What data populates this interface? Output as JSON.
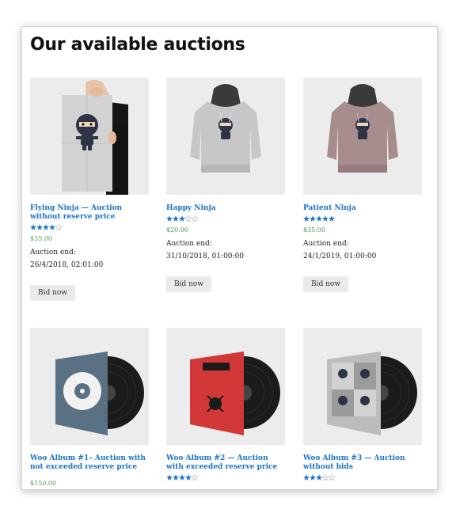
{
  "page": {
    "title": "Our available auctions"
  },
  "colors": {
    "link": "#1a73c9",
    "price": "#4f9a57",
    "star": "#1a73c9",
    "thumb_bg": "#ececec",
    "button_bg": "#ebe9eb"
  },
  "products": [
    {
      "title": "Flying Ninja — Auction without reserve price",
      "rating": 4,
      "price": "$35.00",
      "auction_end_label": "Auction end:",
      "auction_end": "26/4/2018, 02:01:00",
      "button": "Bid now",
      "image": "poster-ninja"
    },
    {
      "title": "Happy Ninja",
      "rating": 3,
      "price": "$20.00",
      "auction_end_label": "Auction end:",
      "auction_end": "31/10/2018, 01:00:00",
      "button": "Bid now",
      "image": "hoodie-grey"
    },
    {
      "title": "Patient Ninja",
      "rating": 5,
      "price": "$35.00",
      "auction_end_label": "Auction end:",
      "auction_end": "24/1/2019, 01:00:00",
      "button": "Bid now",
      "image": "hoodie-mauve"
    },
    {
      "title": "Woo Album #1– Auction with not exceeded reserve price",
      "rating": 0,
      "price": "$150.00",
      "image": "album-blue"
    },
    {
      "title": "Woo Album #2 — Auction with exceeded reserve price",
      "rating": 4,
      "price": "",
      "image": "album-red"
    },
    {
      "title": "Woo Album #3 — Auction without bids",
      "rating": 3,
      "price": "",
      "image": "album-grey"
    }
  ]
}
